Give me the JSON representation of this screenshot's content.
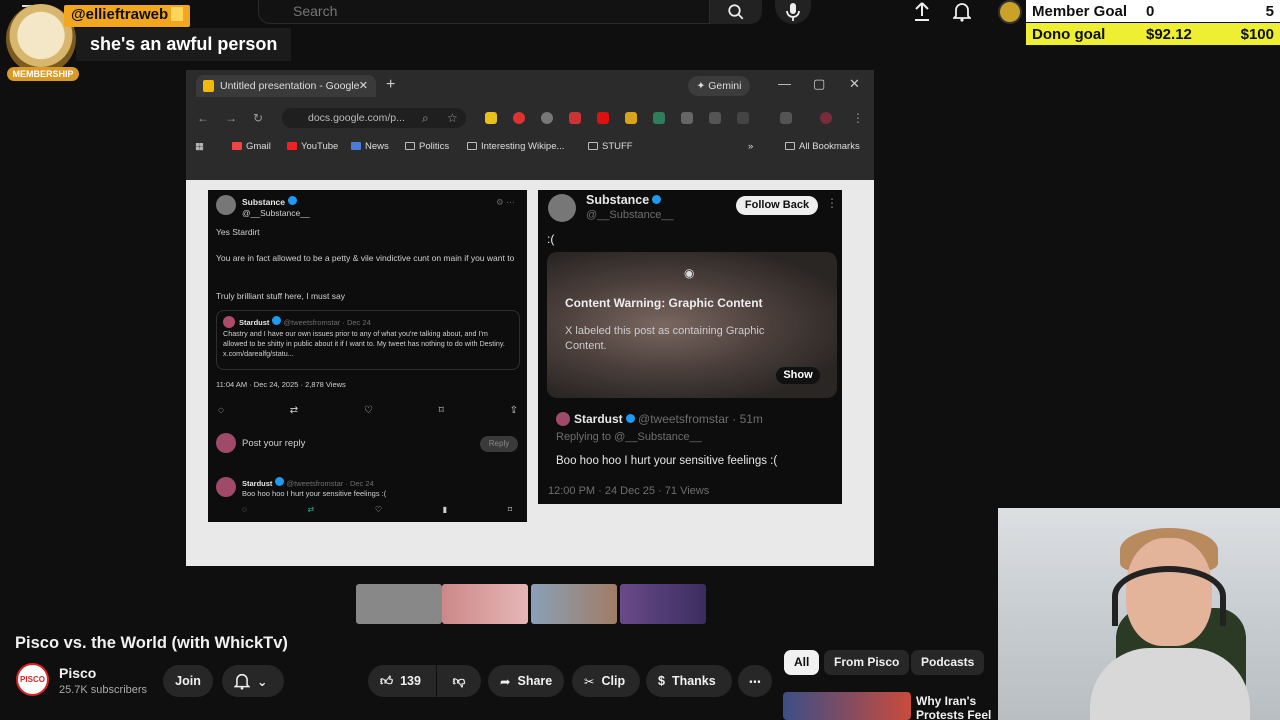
{
  "search": {
    "placeholder": "Search"
  },
  "chat": {
    "username": "@ellieftraweb",
    "badge": "MEMBERSHIP",
    "message": "she's an awful person"
  },
  "goals": {
    "member": {
      "label": "Member Goal",
      "current": "0",
      "target": "5"
    },
    "dono": {
      "label": "Dono goal",
      "current": "$92.12",
      "target": "$100"
    }
  },
  "browser": {
    "tab_title": "Untitled presentation - Google",
    "gemini": "Gemini",
    "url": "docs.google.com/p...",
    "bookmarks": [
      "Gmail",
      "YouTube",
      "News",
      "Politics",
      "Interesting Wikipe...",
      "STUFF"
    ],
    "all_bookmarks": "All Bookmarks"
  },
  "tweet_left": {
    "name": "Substance",
    "handle": "@__Substance__",
    "line1": "Yes Stardirt",
    "line2": "You are in fact allowed to be a petty & vile vindictive cunt on main if you want to",
    "line3": "Truly brilliant stuff here, I must say",
    "quote_name": "Stardust",
    "quote_handle": "@tweetsfromstar · Dec 24",
    "quote_text": "Chastry and I have our own issues prior to any of what you're talking about, and I'm allowed to be shitty in public about it if I want to. My tweet has nothing to do with Destiny. x.com/darealfg/statu...",
    "meta": "11:04 AM · Dec 24, 2025 · 2,878 Views",
    "reply_placeholder": "Post your reply",
    "reply_btn": "Reply",
    "reply_name": "Stardust",
    "reply_handle": "@tweetsfromstar · Dec 24",
    "reply_text": "Boo hoo hoo I hurt your sensitive feelings :("
  },
  "tweet_right": {
    "name": "Substance",
    "handle": "@__Substance__",
    "follow": "Follow Back",
    "text": ":(",
    "warning_title": "Content Warning: Graphic Content",
    "warning_text": "X labeled this post as containing Graphic Content.",
    "show": "Show",
    "reply_name": "Stardust",
    "reply_handle": "@tweetsfromstar · 51m",
    "replying_to": "Replying to @__Substance__",
    "reply_text": "Boo hoo hoo I hurt your sensitive feelings :(",
    "meta": "12:00 PM · 24 Dec 25 · 71 Views"
  },
  "video": {
    "title": "Pisco vs. the World (with WhickTv)",
    "channel": "Pisco",
    "subscribers": "25.7K subscribers",
    "join": "Join",
    "likes": "139",
    "share": "Share",
    "clip": "Clip",
    "thanks": "Thanks"
  },
  "chips": [
    "All",
    "From Pisco",
    "Podcasts"
  ],
  "recommendation": {
    "title": "Why Iran's Protests Feel"
  },
  "colors": {
    "goal_dono": "#eeee33",
    "chat_user": "#f3a71f",
    "background": "#0f0f0f"
  }
}
